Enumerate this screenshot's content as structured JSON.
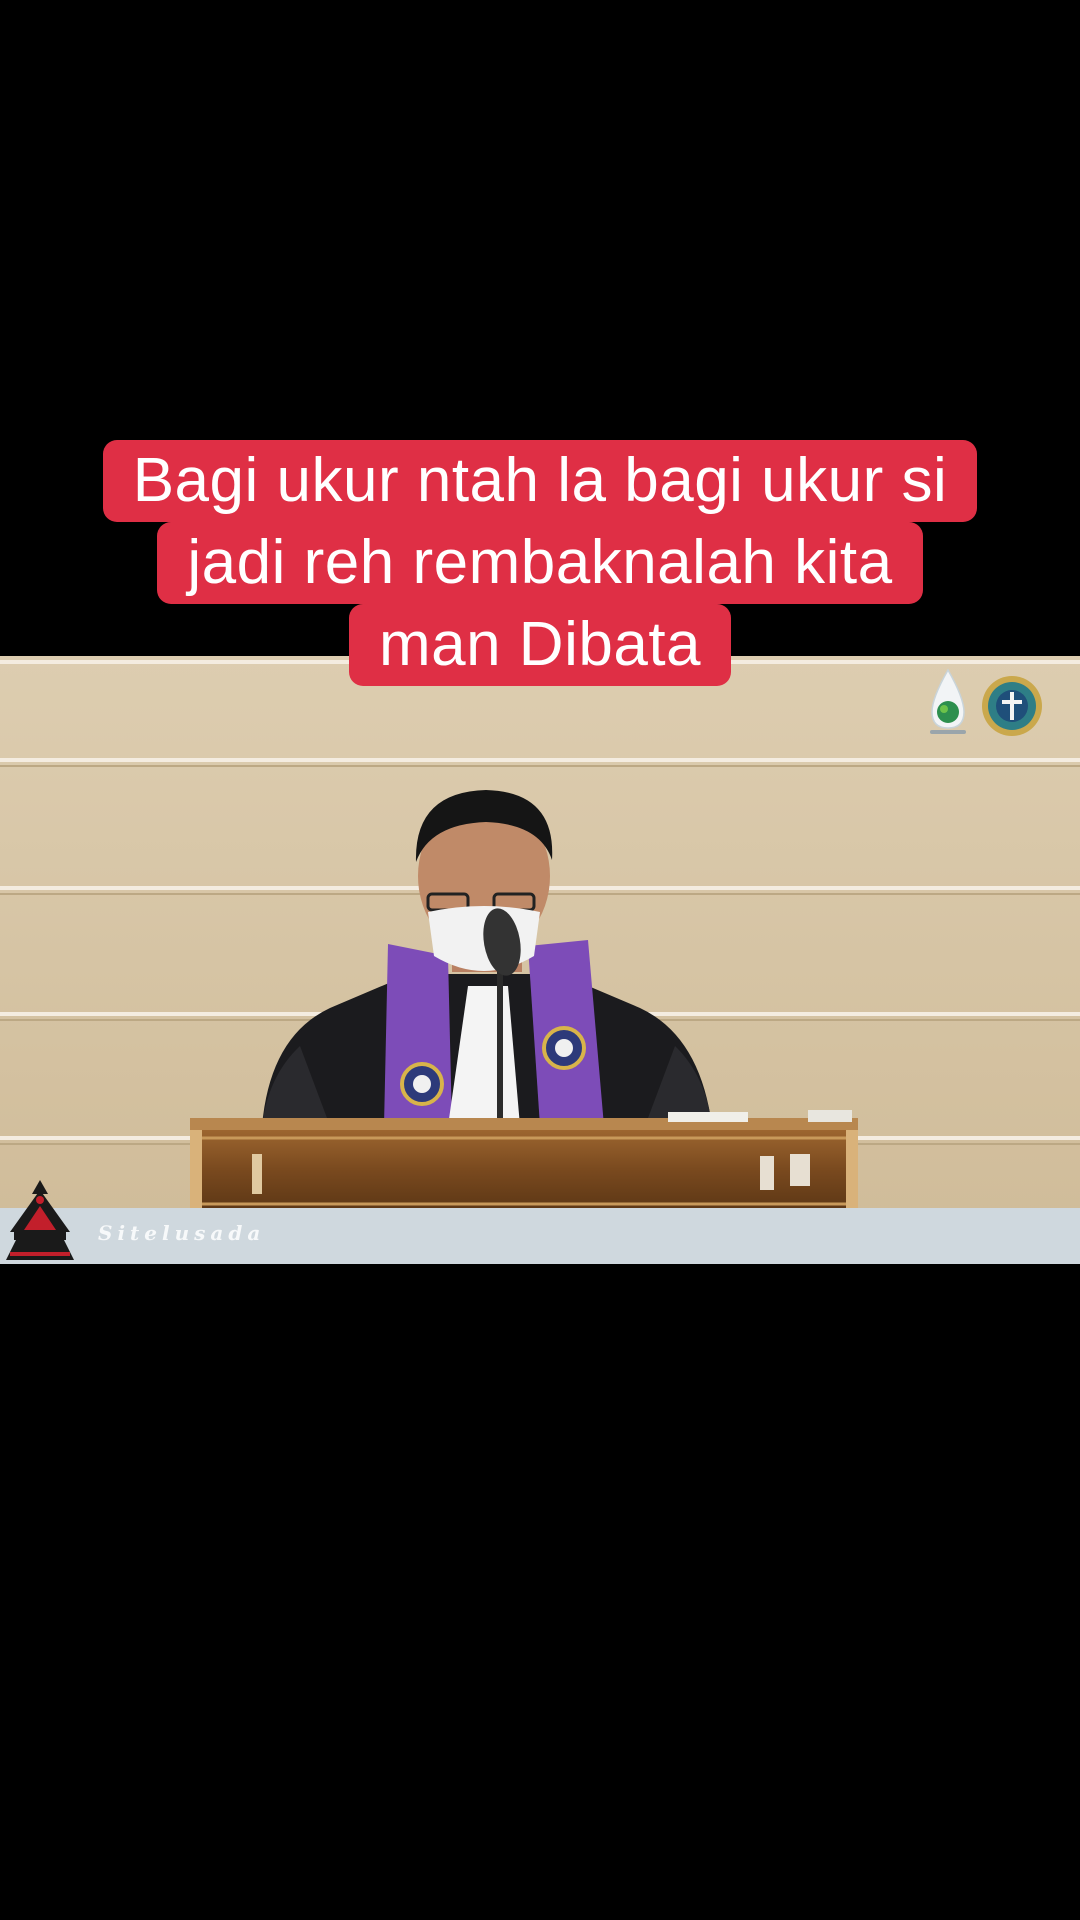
{
  "caption": {
    "lines": [
      "Bagi ukur ntah la bagi ukur si",
      "jadi reh rembaknalah kita",
      "man Dibata"
    ],
    "background_color": "#df2f45",
    "text_color": "#ffffff"
  },
  "video": {
    "lower_bar_text": "Sitelusada",
    "logos": [
      "droplet-globe-logo",
      "church-seal-logo",
      "karo-house-logo"
    ]
  }
}
